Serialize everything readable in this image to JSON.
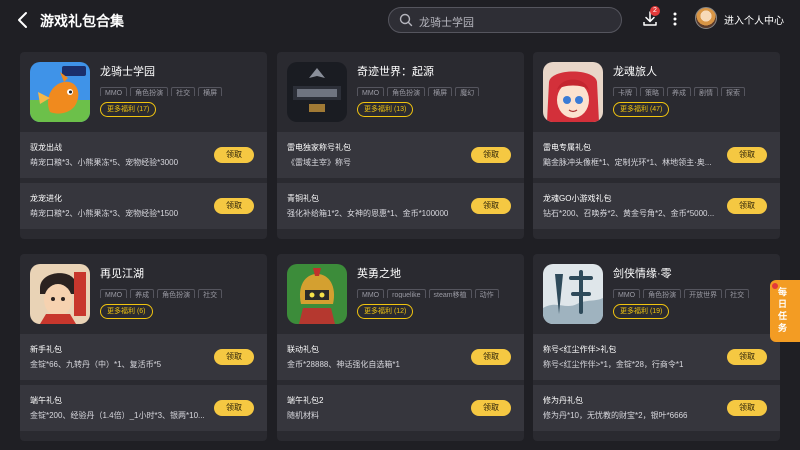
{
  "header": {
    "title": "游戏礼包合集",
    "search_placeholder": "龙骑士学园",
    "download_badge": "2",
    "user_center": "进入个人中心"
  },
  "daily_tasks": "每日任务",
  "claim_label": "领取",
  "cards": [
    {
      "name": "龙骑士学园",
      "tags": [
        "MMO",
        "角色扮演",
        "社交",
        "横屏"
      ],
      "more": "更多福利 (17)",
      "gifts": [
        {
          "title": "驭龙出战",
          "desc": "萌宠口粮*3、小熊果冻*5、宠物经验*3000"
        },
        {
          "title": "龙宠进化",
          "desc": "萌宠口粮*2、小熊果冻*3、宠物经验*1500"
        }
      ]
    },
    {
      "name": "奇迹世界：起源",
      "tags": [
        "MMO",
        "角色扮演",
        "横屏",
        "魔幻"
      ],
      "more": "更多福利 (13)",
      "gifts": [
        {
          "title": "雷电独家称号礼包",
          "desc": "《雷域主宰》称号"
        },
        {
          "title": "青铜礼包",
          "desc": "强化补给箱1*2、女神的恩惠*1、金币*100000"
        }
      ]
    },
    {
      "name": "龙魂旅人",
      "tags": [
        "卡牌",
        "策略",
        "养成",
        "剧情",
        "探索"
      ],
      "more": "更多福利 (47)",
      "gifts": [
        {
          "title": "雷电专属礼包",
          "desc": "黯金脉冲头像框*1、定制光环*1、林地领主·奥..."
        },
        {
          "title": "龙魂GO小游戏礼包",
          "desc": "钻石*200、召唤券*2、黄金号角*2、金币*5000..."
        }
      ]
    },
    {
      "name": "再见江湖",
      "tags": [
        "MMO",
        "养成",
        "角色扮演",
        "社交"
      ],
      "more": "更多福利 (6)",
      "gifts": [
        {
          "title": "新手礼包",
          "desc": "金锭*66、九转丹（中）*1、复活币*5"
        },
        {
          "title": "端午礼包",
          "desc": "金锭*200、经验丹（1.4倍）_1小时*3、银两*10..."
        }
      ]
    },
    {
      "name": "英勇之地",
      "tags": [
        "MMO",
        "roguelike",
        "steam移植",
        "动作"
      ],
      "more": "更多福利 (12)",
      "gifts": [
        {
          "title": "联动礼包",
          "desc": "金币*28888、神话强化自选箱*1"
        },
        {
          "title": "端午礼包2",
          "desc": "随机材料"
        }
      ]
    },
    {
      "name": "剑侠情缘·零",
      "tags": [
        "MMO",
        "角色扮演",
        "开放世界",
        "社交"
      ],
      "more": "更多福利 (19)",
      "gifts": [
        {
          "title": "称号<红尘作伴>礼包",
          "desc": "称号<红尘作伴>*1，金锭*28，行商令*1"
        },
        {
          "title": "修为丹礼包",
          "desc": "修为丹*10，无忧教的财宝*2，银叶*6666"
        }
      ]
    }
  ],
  "icons": {
    "back": "back-arrow-icon",
    "search": "search-icon",
    "download": "download-icon",
    "more": "more-vertical-icon"
  }
}
